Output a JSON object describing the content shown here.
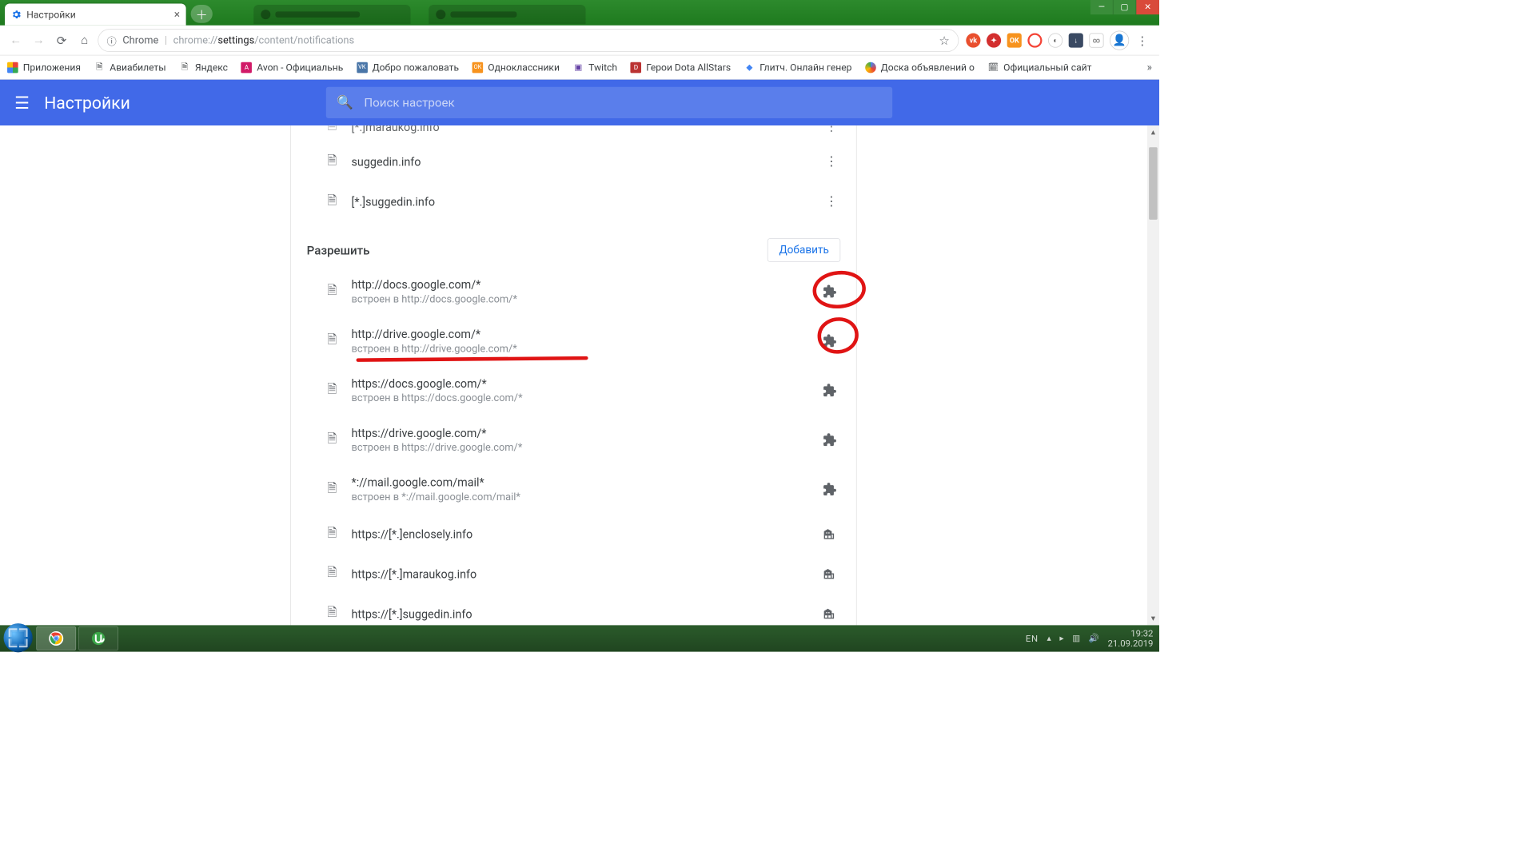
{
  "window_tab": {
    "title": "Настройки"
  },
  "omnibox": {
    "prefix": "Chrome",
    "url_dim_pre": "chrome://",
    "url_bold": "settings",
    "url_dim_post": "/content/notifications"
  },
  "bookmarks": [
    "Приложения",
    "Авиабилеты",
    "Яндекс",
    "Avon - Официальнь",
    "Добро пожаловать",
    "Одноклассники",
    "Twitch",
    "Герои Dota AllStars",
    "Глитч. Онлайн генер",
    "Доска объявлений о",
    "Официальный сайт"
  ],
  "settings_header": {
    "title": "Настройки",
    "search_placeholder": "Поиск настроек"
  },
  "block_list": [
    {
      "primary": "[*.]maraukog.info"
    },
    {
      "primary": "suggedin.info"
    },
    {
      "primary": "[*.]suggedin.info"
    }
  ],
  "allow_section": {
    "title": "Разрешить",
    "add_label": "Добавить"
  },
  "allow_list": [
    {
      "primary": "http://docs.google.com/*",
      "secondary": "встроен в http://docs.google.com/*",
      "icon": "extension"
    },
    {
      "primary": "http://drive.google.com/*",
      "secondary": "встроен в http://drive.google.com/*",
      "icon": "extension"
    },
    {
      "primary": "https://docs.google.com/*",
      "secondary": "встроен в https://docs.google.com/*",
      "icon": "extension"
    },
    {
      "primary": "https://drive.google.com/*",
      "secondary": "встроен в https://drive.google.com/*",
      "icon": "extension"
    },
    {
      "primary": "*://mail.google.com/mail*",
      "secondary": "встроен в *://mail.google.com/mail*",
      "icon": "extension"
    },
    {
      "primary": "https://[*.]enclosely.info",
      "icon": "org"
    },
    {
      "primary": "https://[*.]maraukog.info",
      "icon": "org"
    },
    {
      "primary": "https://[*.]suggedin.info",
      "icon": "org"
    }
  ],
  "taskbar": {
    "lang": "EN",
    "time": "19:32",
    "date": "21.09.2019"
  }
}
